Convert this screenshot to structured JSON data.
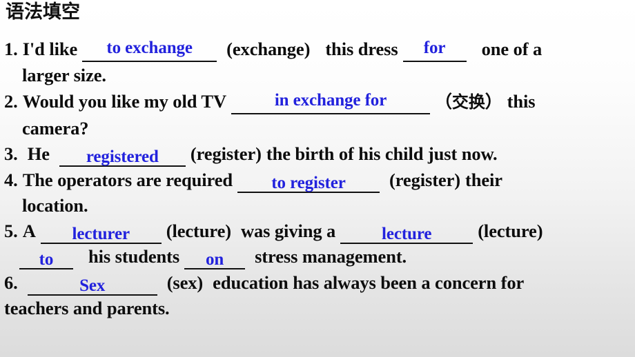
{
  "slide": {
    "title": "语法填空",
    "background_top_color": "#ffffff",
    "background_bottom_color": "#dcdcdc",
    "answer_color": "#2222dd",
    "text_color": "#0d0d0d"
  },
  "exercises": [
    {
      "number": "1.",
      "segments": {
        "before": "I'd like",
        "answer1": "to exchange",
        "cue1": "(exchange)",
        "middle": "this dress",
        "answer2": "for",
        "after": "one of a",
        "continuation": "larger size."
      }
    },
    {
      "number": "2.",
      "segments": {
        "before": "Would you like my old TV",
        "answer1": "in exchange for",
        "gloss_open": "（",
        "gloss": "交换",
        "gloss_close": "）",
        "after": "this",
        "continuation": "camera?"
      }
    },
    {
      "number": "3.",
      "segments": {
        "before": "He",
        "answer1": "registered",
        "cue1": "(register)",
        "after": "the birth of his child just now."
      }
    },
    {
      "number": "4.",
      "segments": {
        "before": "The operators are required",
        "answer1": "to register",
        "cue1": "(register)",
        "after": "their",
        "continuation": "location."
      }
    },
    {
      "number": "5.",
      "segments": {
        "before": "A",
        "answer1": "lecturer",
        "cue1": "(lecture)",
        "middle": "was giving a",
        "answer2": "lecture",
        "cue2": "(lecture)",
        "answer3": "to",
        "middle2": "his students",
        "answer4": "on",
        "after": "stress management."
      }
    },
    {
      "number": "6.",
      "segments": {
        "answer1": "Sex",
        "cue1": "(sex)",
        "after": "education has always been a concern for",
        "continuation": "teachers and parents."
      }
    }
  ]
}
